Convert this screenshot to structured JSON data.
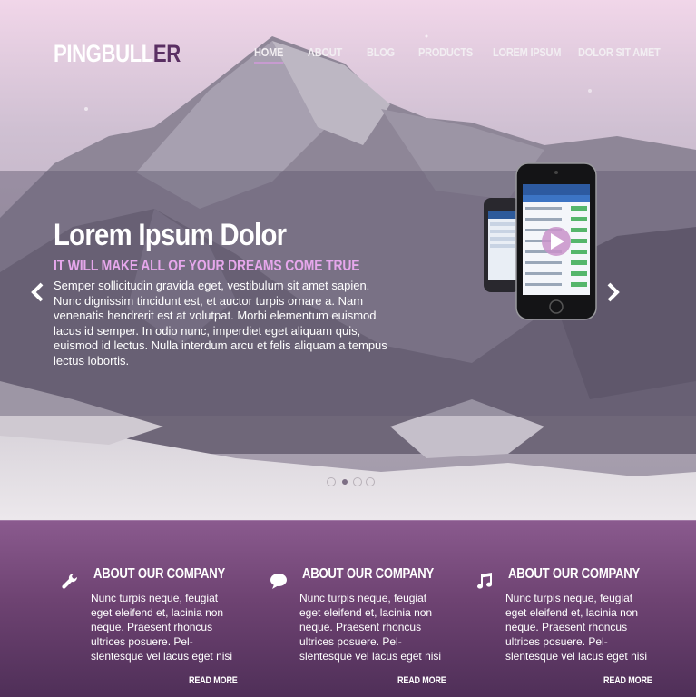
{
  "logo": {
    "part1": "PINGBULL",
    "part2": "ER"
  },
  "nav": [
    {
      "label": "HOME",
      "active": true
    },
    {
      "label": "ABOUT"
    },
    {
      "label": "BLOG"
    },
    {
      "label": "PRODUCTS"
    },
    {
      "label": "LOREM IPSUM"
    },
    {
      "label": "DOLOR SIT AMET"
    }
  ],
  "hero": {
    "title": "Lorem Ipsum Dolor",
    "subtitle": "IT WILL MAKE ALL OF YOUR DREAMS COME TRUE",
    "text": "Semper sollicitudin gravida eget, vestibulum sit amet sapien. Nunc dignissim tincidunt est, et auctor turpis ornare a. Nam venenatis hendrerit est at volutpat. Morbi elementum euismod lacus id semper. In odio nunc, imperdiet eget aliquam quis, euismod id lectus. Nulla interdum arcu et felis aliquam a tempus lectus lobortis.",
    "prev_icon": "chevron-left-icon",
    "next_icon": "chevron-right-icon",
    "slides": 4,
    "active_slide": 2
  },
  "features": [
    {
      "icon": "wrench-icon",
      "title": "ABOUT OUR COMPANY",
      "text": "Nunc turpis neque, feugiat eget eleifend et, lacinia non neque. Praesent rhoncus ultrices posuere. Pel-slentesque vel lacus eget nisi",
      "more": "READ MORE"
    },
    {
      "icon": "speech-bubble-icon",
      "title": "ABOUT OUR COMPANY",
      "text": "Nunc turpis neque, feugiat eget eleifend et, lacinia non neque. Praesent rhoncus ultrices posuere. Pel-slentesque vel lacus eget nisi",
      "more": "READ MORE"
    },
    {
      "icon": "music-note-icon",
      "title": "ABOUT OUR COMPANY",
      "text": "Nunc turpis neque, feugiat eget eleifend et, lacinia non neque. Praesent rhoncus ultrices posuere. Pel-slentesque vel lacus eget nisi",
      "more": "READ MORE"
    }
  ],
  "colors": {
    "accent": "#c79bd0",
    "subtitle": "#e6a7ec",
    "footer": "#6e4372",
    "logo_dark": "#5a2f63"
  }
}
